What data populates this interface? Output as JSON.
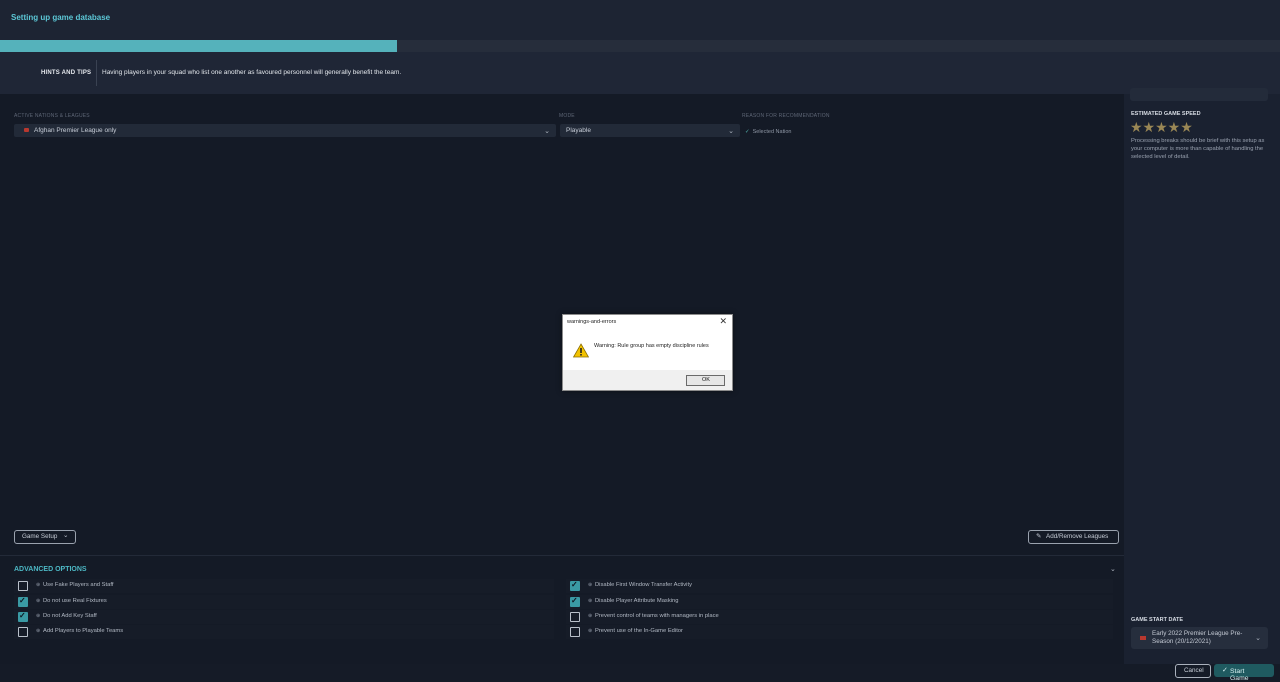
{
  "header": {
    "title": "Setting up game database",
    "progress_fraction": 0.31
  },
  "hints": {
    "label": "HINTS AND TIPS",
    "text": "Having players in your squad who list one another as favoured personnel will generally benefit the team."
  },
  "columns": {
    "nations_label": "ACTIVE NATIONS & LEAGUES",
    "mode_label": "MODE",
    "reason_label": "REASON FOR RECOMMENDATION"
  },
  "nations_select": {
    "value": "Afghan Premier League only"
  },
  "mode_select": {
    "value": "Playable"
  },
  "reason": {
    "value": "Selected Nation"
  },
  "buttons": {
    "game_setup": "Game Setup",
    "add_remove": "Add/Remove Leagues",
    "cancel": "Cancel",
    "start": "Start Game"
  },
  "advanced": {
    "title": "ADVANCED OPTIONS",
    "left": [
      {
        "label": "Use Fake Players and Staff",
        "checked": false
      },
      {
        "label": "Do not use Real Fixtures",
        "checked": true
      },
      {
        "label": "Do not Add Key Staff",
        "checked": true
      },
      {
        "label": "Add Players to Playable Teams",
        "checked": false
      }
    ],
    "right": [
      {
        "label": "Disable First Window Transfer Activity",
        "checked": true
      },
      {
        "label": "Disable Player Attribute Masking",
        "checked": true
      },
      {
        "label": "Prevent control of teams with managers in place",
        "checked": false
      },
      {
        "label": "Prevent use of the In-Game Editor",
        "checked": false
      }
    ]
  },
  "speed": {
    "title": "ESTIMATED GAME SPEED",
    "stars": "★★★★★",
    "rating": 5,
    "text": "Processing breaks should be brief with this setup as your computer is more than capable of handling the selected level of detail."
  },
  "start_date": {
    "title": "GAME START DATE",
    "value": "Early 2022 Premier League Pre-Season (20/12/2021)"
  },
  "dialog": {
    "title": "warnings-and-errors",
    "message": "Warning: Rule group has empty discipline rules",
    "ok": "OK"
  }
}
